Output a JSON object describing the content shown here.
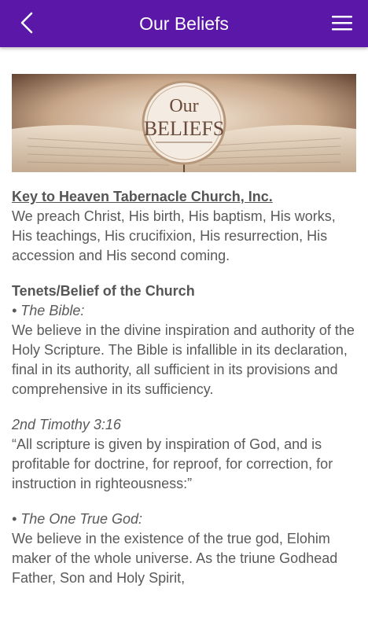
{
  "header": {
    "title": "Our Beliefs",
    "back_icon": "chevron-left-icon",
    "menu_icon": "hamburger-menu-icon",
    "color": "#5b17a8"
  },
  "banner": {
    "logo_line1": "Our",
    "logo_line2": "BELIEFS"
  },
  "content": {
    "church_name": "Key to Heaven Tabernacle Church, Inc.",
    "intro": "We preach Christ, His birth, His baptism, His works, His teachings, His crucifixion, His resurrection, His accession and His second coming.",
    "tenets_heading": "Tenets/Belief of the Church",
    "items": [
      {
        "title": "• The Bible:",
        "text": "We believe in the divine inspiration and authority of the Holy Scripture. The Bible is infallible in its declaration, final in its authority, all sufficient in its provisions and comprehensive in its sufficiency."
      }
    ],
    "scripture_ref": "2nd Timothy 3:16",
    "scripture_text": "“All scripture is given by inspiration of God, and is profitable for doctrine, for reproof, for correction, for instruction in righteousness:”",
    "item2_title": "• The One True God:",
    "item2_text": "We believe in the existence of the true god, Elohim maker of the whole universe. As the triune Godhead Father, Son and Holy Spirit,"
  }
}
